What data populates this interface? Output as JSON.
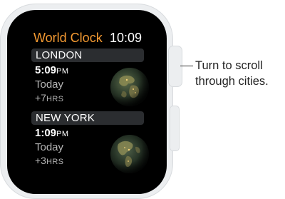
{
  "app": {
    "title": "World Clock",
    "current_time": "10:09"
  },
  "cities": [
    {
      "name": "LONDON",
      "time": "5:09",
      "ampm": "PM",
      "day": "Today",
      "offset": "+7",
      "offset_unit": "HRS",
      "icon": "globe-night-icon"
    },
    {
      "name": "NEW YORK",
      "time": "1:09",
      "ampm": "PM",
      "day": "Today",
      "offset": "+3",
      "offset_unit": "HRS",
      "icon": "globe-night-icon"
    }
  ],
  "annotation": {
    "line1": "Turn to scroll",
    "line2": "through cities."
  },
  "colors": {
    "accent": "#f59a32",
    "screen": "#000000",
    "case": "#eceef0",
    "row_header": "#2b2d30"
  }
}
